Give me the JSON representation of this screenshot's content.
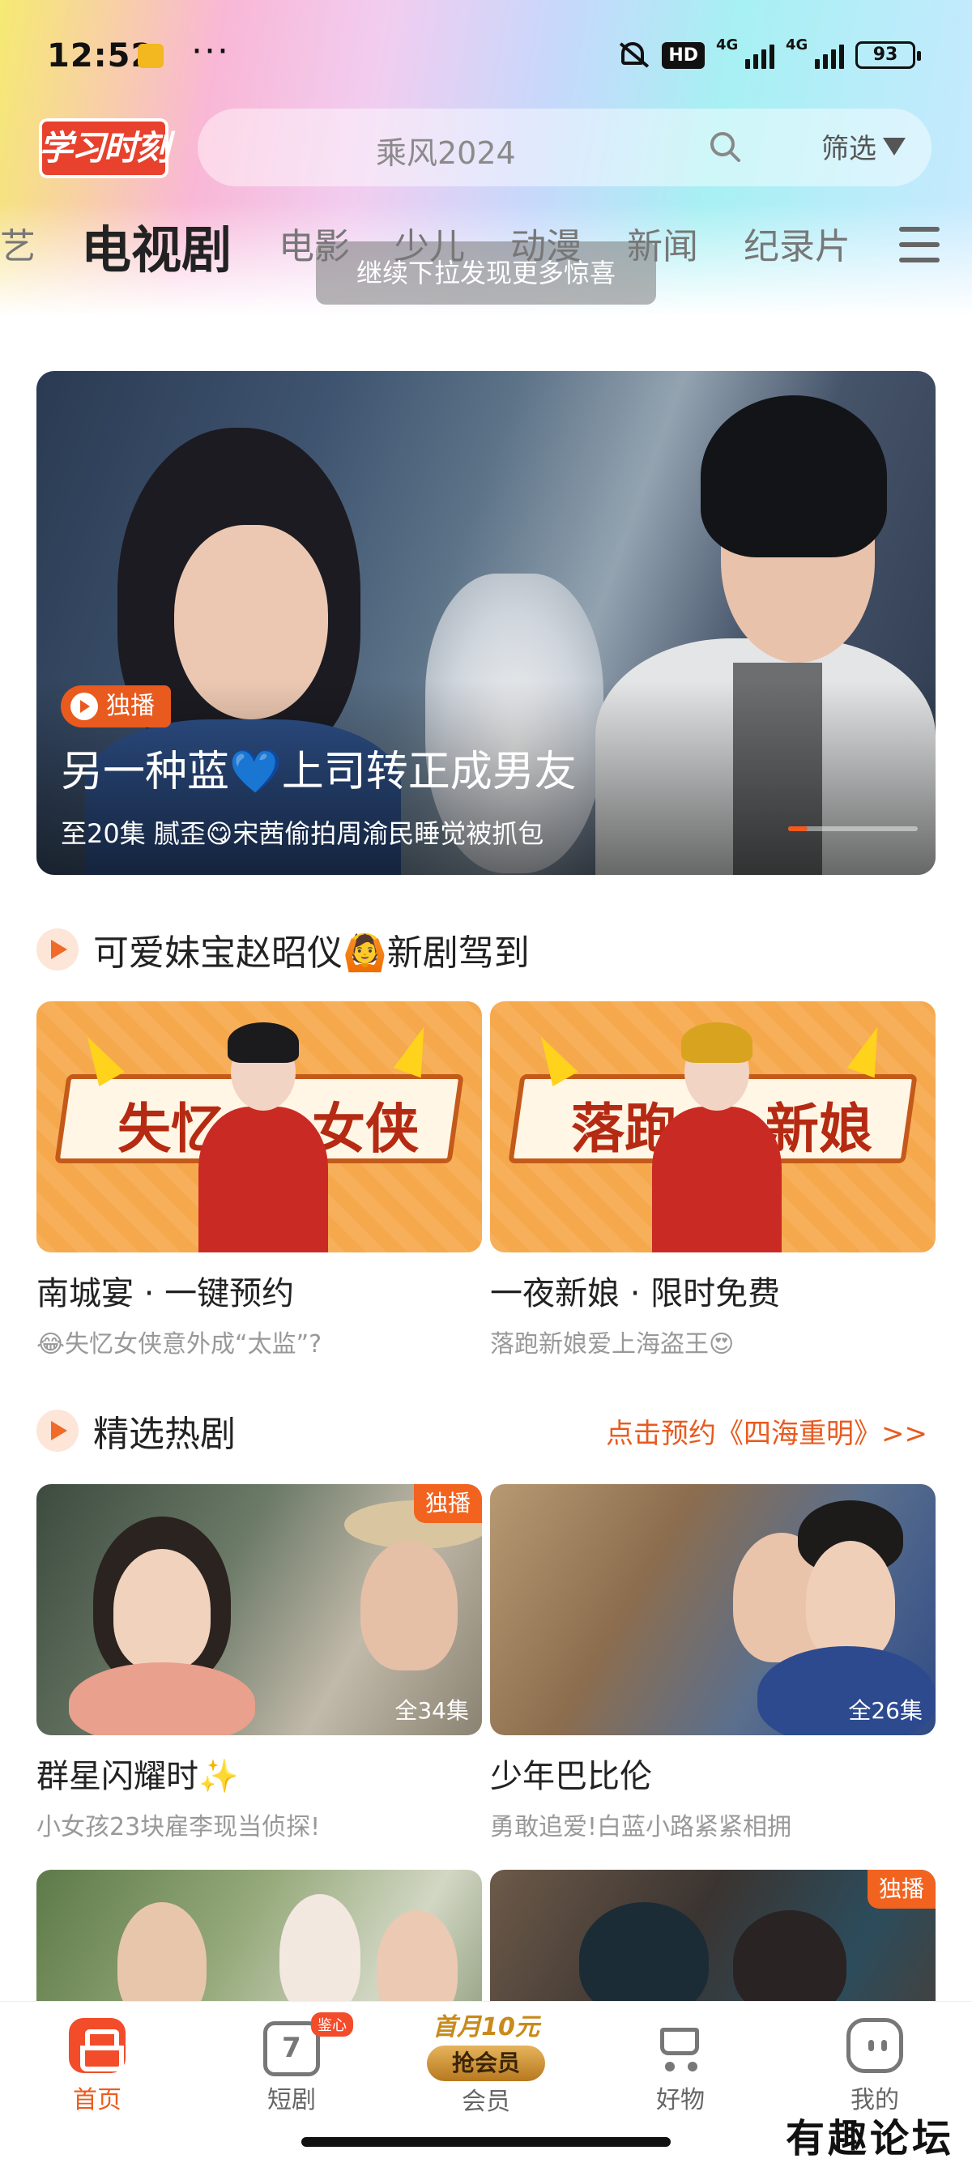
{
  "status_bar": {
    "time": "12:52",
    "more": "···",
    "hd": "HD",
    "signal1_label": "4G",
    "signal2_label": "4G",
    "battery": "93"
  },
  "header": {
    "logo_text": "学习时刻",
    "search_placeholder": "乘风2024",
    "filter_label": "筛选"
  },
  "channel_tabs": [
    {
      "label": "艺"
    },
    {
      "label": "电视剧",
      "active": true
    },
    {
      "label": "电影"
    },
    {
      "label": "少儿"
    },
    {
      "label": "动漫"
    },
    {
      "label": "新闻"
    },
    {
      "label": "纪录片"
    }
  ],
  "pull_tip": "继续下拉发现更多惊喜",
  "hero": {
    "tag": "独播",
    "title_part1": "另一种蓝",
    "title_heart": "💙",
    "title_part2": "上司转正成男友",
    "subtitle": "至20集 腻歪😋宋茜偷拍周渝民睡觉被抓包",
    "carousel_active_index": 0
  },
  "section1": {
    "title": "可爱妹宝赵昭仪🙆新剧驾到",
    "cards": [
      {
        "promo_words": [
          "失忆",
          "女侠"
        ],
        "title": "南城宴 · 一键预约",
        "subtitle": "😂失忆女侠意外成“太监”?"
      },
      {
        "promo_words": [
          "落跑",
          "新娘"
        ],
        "title": "一夜新娘 · 限时免费",
        "subtitle": "落跑新娘爱上海盗王😍"
      }
    ]
  },
  "section2": {
    "title": "精选热剧",
    "link": "点击预约《四海重明》>>",
    "cards": [
      {
        "tag": "独播",
        "episodes": "全34集",
        "title": "群星闪耀时✨",
        "subtitle": "小女孩23块雇李现当侦探!"
      },
      {
        "tag": "",
        "episodes": "全26集",
        "title": "少年巴比伦",
        "subtitle": "勇敢追爱!白蓝小路紧紧相拥"
      },
      {
        "tag": "",
        "episodes": "",
        "title": "",
        "subtitle": ""
      },
      {
        "tag": "独播",
        "episodes": "",
        "title": "",
        "subtitle": ""
      }
    ]
  },
  "bottom_nav": {
    "items": [
      {
        "label": "首页",
        "active": true
      },
      {
        "label": "短剧",
        "badge": "鉴心"
      },
      {
        "label": "会员",
        "promo": "首月10元",
        "pill": "抢会员"
      },
      {
        "label": "好物"
      },
      {
        "label": "我的"
      }
    ]
  },
  "watermark": "有趣论坛",
  "colors": {
    "accent": "#ef5a1e",
    "logo_red": "#e8412d",
    "text_primary": "#222222",
    "text_secondary": "#999999"
  }
}
